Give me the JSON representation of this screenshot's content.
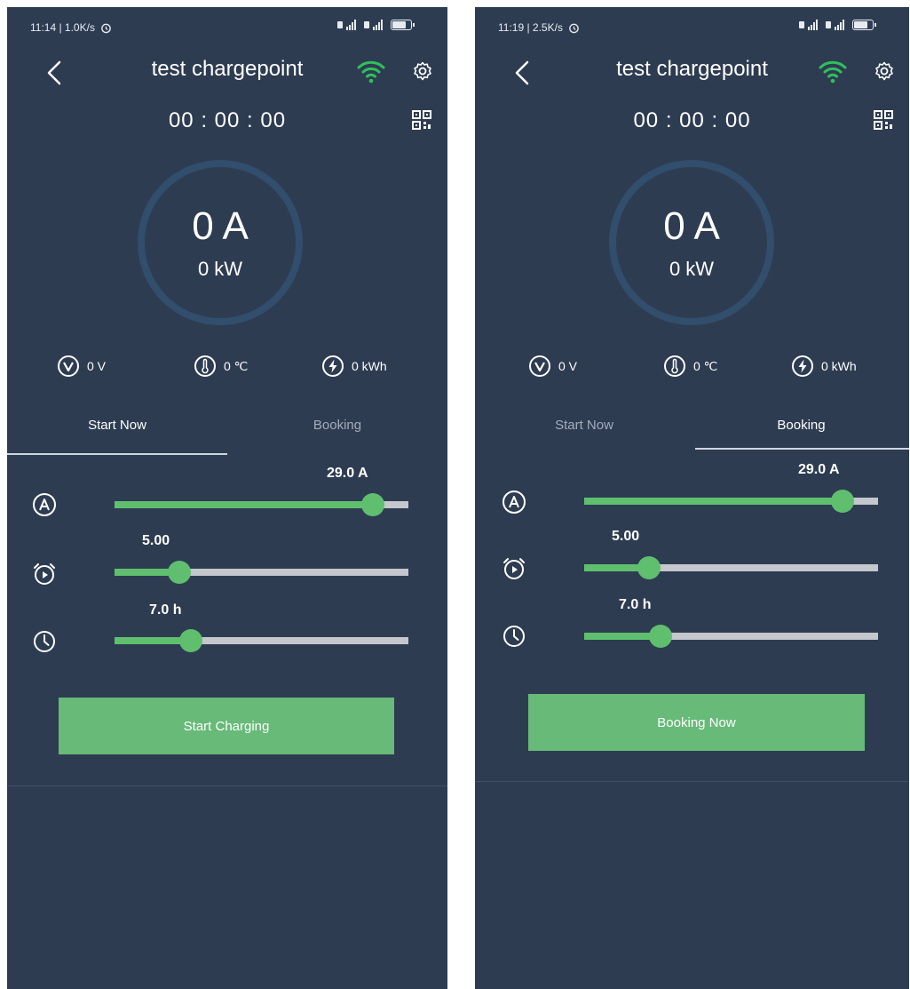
{
  "colors": {
    "background": "#2e3c52",
    "accent": "#5fbf6f",
    "track": "#c4c7cc",
    "ring": "#314e6c"
  },
  "screens": [
    {
      "status": {
        "left": "11:14 | 1.0K/s"
      },
      "title": "test chargepoint",
      "timer": "00 : 00 : 00",
      "current": "0 A",
      "power": "0 kW",
      "metrics": {
        "voltage": "0 V",
        "temperature": "0 ℃",
        "energy": "0 kWh"
      },
      "tabs": [
        "Start Now",
        "Booking"
      ],
      "active_tab": "Start Now",
      "sliders": [
        {
          "icon": "amperage-icon",
          "value": "29.0 A",
          "level": 0.88
        },
        {
          "icon": "alarm-clock-icon",
          "value": "5.00",
          "level": 0.22
        },
        {
          "icon": "clock-icon",
          "value": "7.0 h",
          "level": 0.26
        }
      ],
      "action_label": "Start Charging"
    },
    {
      "status": {
        "left": "11:19 | 2.5K/s"
      },
      "title": "test chargepoint",
      "timer": "00 : 00 : 00",
      "current": "0 A",
      "power": "0 kW",
      "metrics": {
        "voltage": "0 V",
        "temperature": "0 ℃",
        "energy": "0 kWh"
      },
      "tabs": [
        "Start Now",
        "Booking"
      ],
      "active_tab": "Booking",
      "sliders": [
        {
          "icon": "amperage-icon",
          "value": "29.0 A",
          "level": 0.88
        },
        {
          "icon": "alarm-clock-icon",
          "value": "5.00",
          "level": 0.22
        },
        {
          "icon": "clock-icon",
          "value": "7.0 h",
          "level": 0.26
        }
      ],
      "action_label": "Booking Now"
    }
  ]
}
